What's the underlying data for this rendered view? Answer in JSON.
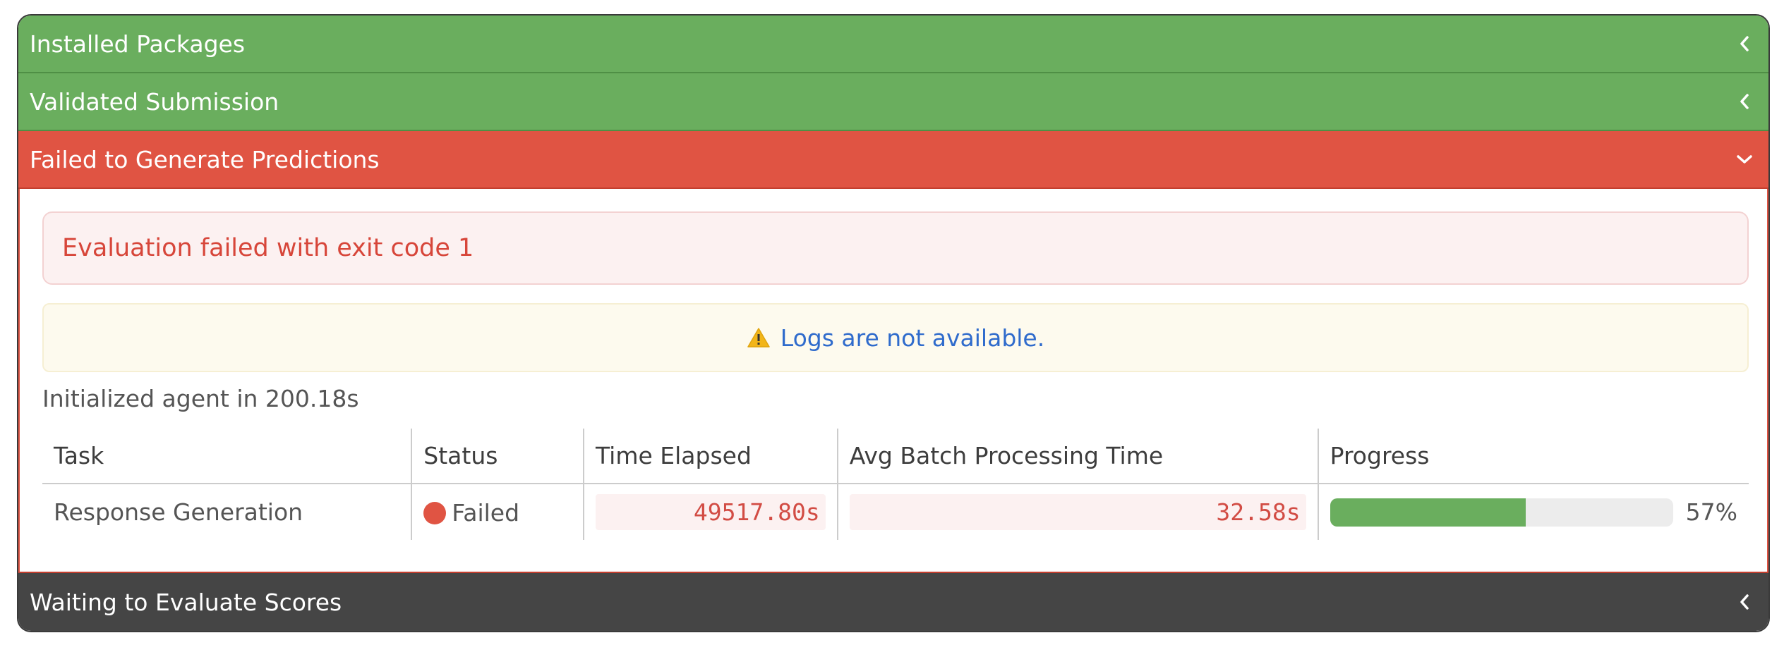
{
  "panels": [
    {
      "title": "Installed Packages",
      "state": "success",
      "expanded": false,
      "icon": "chevron-left-icon"
    },
    {
      "title": "Validated Submission",
      "state": "success",
      "expanded": false,
      "icon": "chevron-left-icon"
    },
    {
      "title": "Failed to Generate Predictions",
      "state": "danger",
      "expanded": true,
      "icon": "chevron-down-icon"
    },
    {
      "title": "Waiting to Evaluate Scores",
      "state": "pending",
      "expanded": false,
      "icon": "chevron-left-icon"
    }
  ],
  "failed_panel": {
    "error_message": "Evaluation failed with exit code 1",
    "logs_warning": "Logs are not available.",
    "warning_icon": "warning-triangle-icon",
    "init_text": "Initialized agent in 200.18s",
    "table": {
      "headers": [
        "Task",
        "Status",
        "Time Elapsed",
        "Avg Batch Processing Time",
        "Progress"
      ],
      "rows": [
        {
          "task": "Response Generation",
          "status": "Failed",
          "time_elapsed": "49517.80s",
          "avg_batch_time": "32.58s",
          "progress_percent": 57,
          "progress_label": "57%"
        }
      ]
    }
  },
  "colors": {
    "success": "#6aae5e",
    "danger": "#e05443",
    "pending": "#454545",
    "link_blue": "#2f6bcc",
    "warning_yellow": "#f2b519"
  }
}
